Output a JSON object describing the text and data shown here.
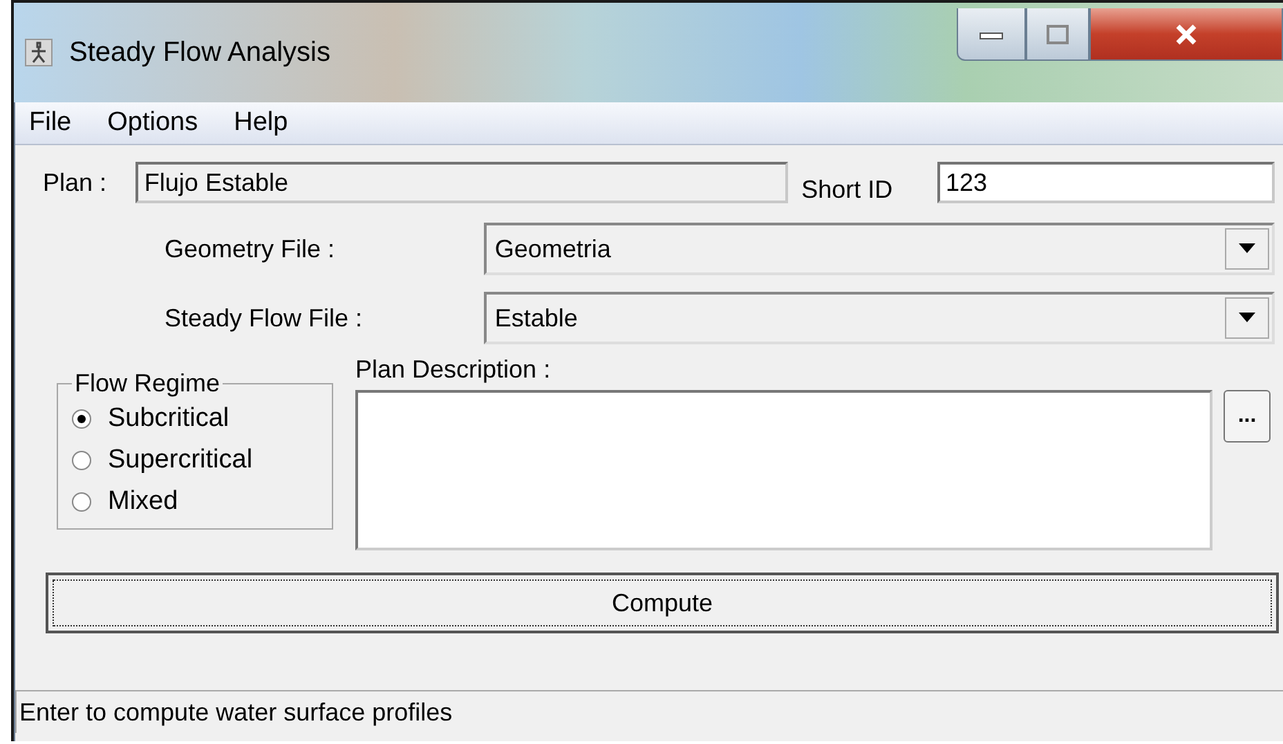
{
  "window": {
    "title": "Steady Flow Analysis"
  },
  "menu": [
    "File",
    "Options",
    "Help"
  ],
  "plan": {
    "label": "Plan :",
    "value": "Flujo Estable"
  },
  "short_id": {
    "label": "Short ID",
    "value": "123"
  },
  "files": [
    {
      "label": "Geometry File :",
      "value": "Geometria"
    },
    {
      "label": "Steady Flow File :",
      "value": "Estable"
    }
  ],
  "flow_regime": {
    "title": "Flow Regime",
    "options": [
      {
        "label": "Subcritical",
        "selected": true
      },
      {
        "label": "Supercritical",
        "selected": false
      },
      {
        "label": "Mixed",
        "selected": false
      }
    ]
  },
  "plan_description": {
    "label": "Plan Description :",
    "browse_button": "..."
  },
  "compute_button": "Compute",
  "status_bar": "Enter to compute water surface profiles"
}
